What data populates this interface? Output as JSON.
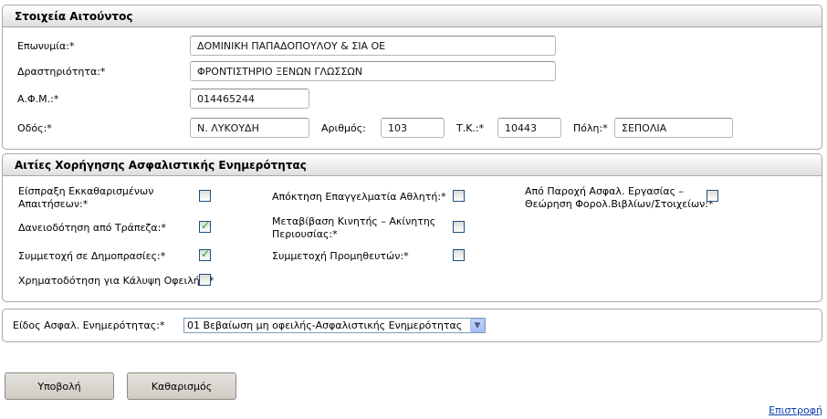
{
  "applicant": {
    "title": "Στοιχεία Αιτούντος",
    "name_label": "Επωνυμία:*",
    "name_value": "ΔΟΜΙΝΙΚΗ ΠΑΠΑΔΟΠΟΥΛΟΥ & ΣΙΑ ΟΕ",
    "activity_label": "Δραστηριότητα:*",
    "activity_value": "ΦΡΟΝΤΙΣΤΗΡΙΟ ΞΕΝΩΝ ΓΛΩΣΣΩΝ",
    "afm_label": "Α.Φ.Μ.:*",
    "afm_value": "014465244",
    "street_label": "Οδός:*",
    "street_value": "Ν. ΛΥΚΟΥΔΗ",
    "number_label": "Αριθμός:",
    "number_value": "103",
    "zip_label": "Τ.Κ.:*",
    "zip_value": "10443",
    "city_label": "Πόλη:*",
    "city_value": "ΣΕΠΟΛΙΑ"
  },
  "reasons": {
    "title": "Αιτίες Χορήγησης Ασφαλιστικής Ενημερότητας",
    "items": [
      {
        "label_line1": "Είσπραξη Εκκαθαρισμένων",
        "label_line2": "Απαιτήσεων:*",
        "checked": false
      },
      {
        "label_line1": "Απόκτηση Επαγγελματία Αθλητή:*",
        "label_line2": "",
        "checked": false
      },
      {
        "label_line1": "Από Παροχή Ασφαλ. Εργασίας –",
        "label_line2": "Θεώρηση Φορολ.Βιβλίων/Στοιχείων:*",
        "checked": false
      },
      {
        "label_line1": "Δανειοδότηση από Τράπεζα:*",
        "label_line2": "",
        "checked": true
      },
      {
        "label_line1": "Μεταβίβαση Κινητής – Ακίνητης",
        "label_line2": "Περιουσίας:*",
        "checked": false
      },
      {
        "label_line1": "Συμμετοχή σε Δημοπρασίες:*",
        "label_line2": "",
        "checked": true
      },
      {
        "label_line1": "Συμμετοχή Προμηθευτών:*",
        "label_line2": "",
        "checked": false
      },
      {
        "label_line1": "Χρηματοδότηση για Κάλυψη Οφειλής:*",
        "label_line2": "",
        "checked": false
      }
    ]
  },
  "certificate": {
    "type_label": "Είδος Ασφαλ. Ενημερότητας:*",
    "type_value": "01 Βεβαίωση μη οφειλής-Ασφαλιστικής Ενημερότητας"
  },
  "actions": {
    "submit_label": "Υποβολή",
    "clear_label": "Καθαρισμός",
    "back_label": "Επιστροφή"
  }
}
